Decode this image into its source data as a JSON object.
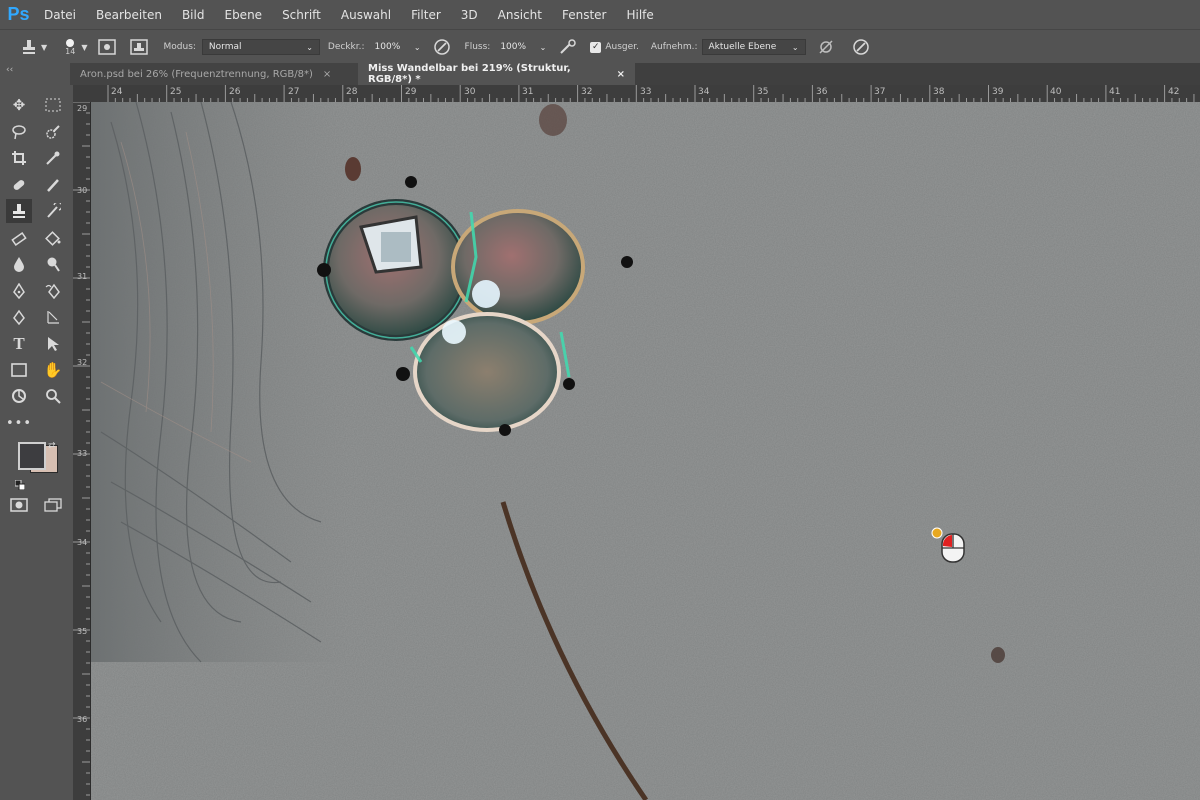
{
  "app": {
    "logo_text": "Ps",
    "accent": "#31a8ff"
  },
  "menu": [
    "Datei",
    "Bearbeiten",
    "Bild",
    "Ebene",
    "Schrift",
    "Auswahl",
    "Filter",
    "3D",
    "Ansicht",
    "Fenster",
    "Hilfe"
  ],
  "options": {
    "brush_size": "14",
    "mode_label": "Modus:",
    "mode_value": "Normal",
    "opacity_label": "Deckkr.:",
    "opacity_value": "100%",
    "flow_label": "Fluss:",
    "flow_value": "100%",
    "aligned_label": "Ausger.",
    "aligned_checked": true,
    "sample_label": "Aufnehm.:",
    "sample_value": "Aktuelle Ebene"
  },
  "tabs": [
    {
      "title": "Aron.psd bei 26% (Frequenztrennung, RGB/8*)",
      "close": "×",
      "active": false
    },
    {
      "title": "Miss Wandelbar bei 219% (Struktur, RGB/8*) *",
      "close": "×",
      "active": true
    }
  ],
  "ruler_top": [
    "24",
    "25",
    "26",
    "27",
    "28",
    "29",
    "30",
    "31",
    "32",
    "33",
    "34",
    "35",
    "36",
    "37",
    "38",
    "39",
    "40",
    "41",
    "42"
  ],
  "ruler_left": [
    "29",
    "30",
    "31",
    "32",
    "33",
    "34",
    "35",
    "36"
  ],
  "toolbar_collapse": "‹‹",
  "colors": {
    "foreground": "#3d3d40",
    "background": "#d7bfb2"
  }
}
